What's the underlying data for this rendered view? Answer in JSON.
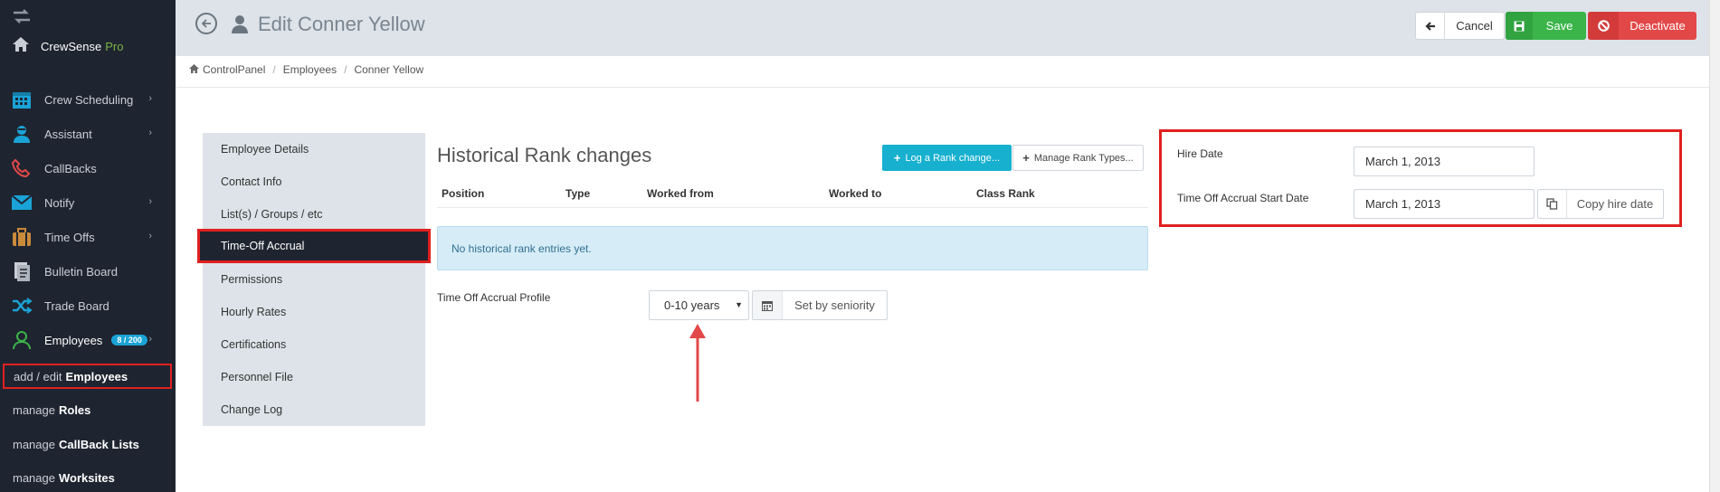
{
  "sidebar": {
    "brand": {
      "name": "CrewSense",
      "suffix": "Pro"
    },
    "items": [
      {
        "label": "Crew Scheduling",
        "icon": "calendar-icon",
        "color": "#1aa3d6"
      },
      {
        "label": "Assistant",
        "icon": "assistant-icon",
        "color": "#1aa3d6"
      },
      {
        "label": "CallBacks",
        "icon": "phone-icon",
        "color": "#e34848"
      },
      {
        "label": "Notify",
        "icon": "envelope-icon",
        "color": "#1aa3d6"
      },
      {
        "label": "Time Offs",
        "icon": "suitcase-icon",
        "color": "#c98a3a"
      },
      {
        "label": "Bulletin Board",
        "icon": "document-icon",
        "color": "#c9ced6"
      },
      {
        "label": "Trade Board",
        "icon": "shuffle-icon",
        "color": "#1aa3d6"
      },
      {
        "label": "Employees",
        "icon": "user-icon",
        "color": "#3bb54a",
        "badge": "8 / 200"
      }
    ],
    "sub": [
      {
        "prefix": "add / edit",
        "bold": "Employees"
      },
      {
        "prefix": "manage",
        "bold": "Roles"
      },
      {
        "prefix": "manage",
        "bold": "CallBack Lists"
      },
      {
        "prefix": "manage",
        "bold": "Worksites"
      }
    ]
  },
  "header": {
    "title": "Edit Conner Yellow",
    "cancel_label": "Cancel",
    "save_label": "Save",
    "deactivate_label": "Deactivate"
  },
  "breadcrumb": [
    "ControlPanel",
    "Employees",
    "Conner Yellow"
  ],
  "tabs": [
    "Employee Details",
    "Contact Info",
    "List(s) / Groups / etc",
    "Time-Off Accrual",
    "Permissions",
    "Hourly Rates",
    "Certifications",
    "Personnel File",
    "Change Log"
  ],
  "active_tab": "Time-Off Accrual",
  "history": {
    "title": "Historical Rank changes",
    "log_button": "Log a Rank change...",
    "manage_button": "Manage Rank Types...",
    "columns": [
      "Position",
      "Type",
      "Worked from",
      "Worked to",
      "Class Rank"
    ],
    "empty_message": "No historical rank entries yet."
  },
  "accrual": {
    "profile_label": "Time Off Accrual Profile",
    "profile_value": "0-10 years",
    "seniority_button": "Set by seniority"
  },
  "dates": {
    "hire_label": "Hire Date",
    "hire_value": "March 1, 2013",
    "accrual_start_label": "Time Off Accrual Start Date",
    "accrual_start_value": "March 1, 2013",
    "copy_button": "Copy hire date"
  }
}
